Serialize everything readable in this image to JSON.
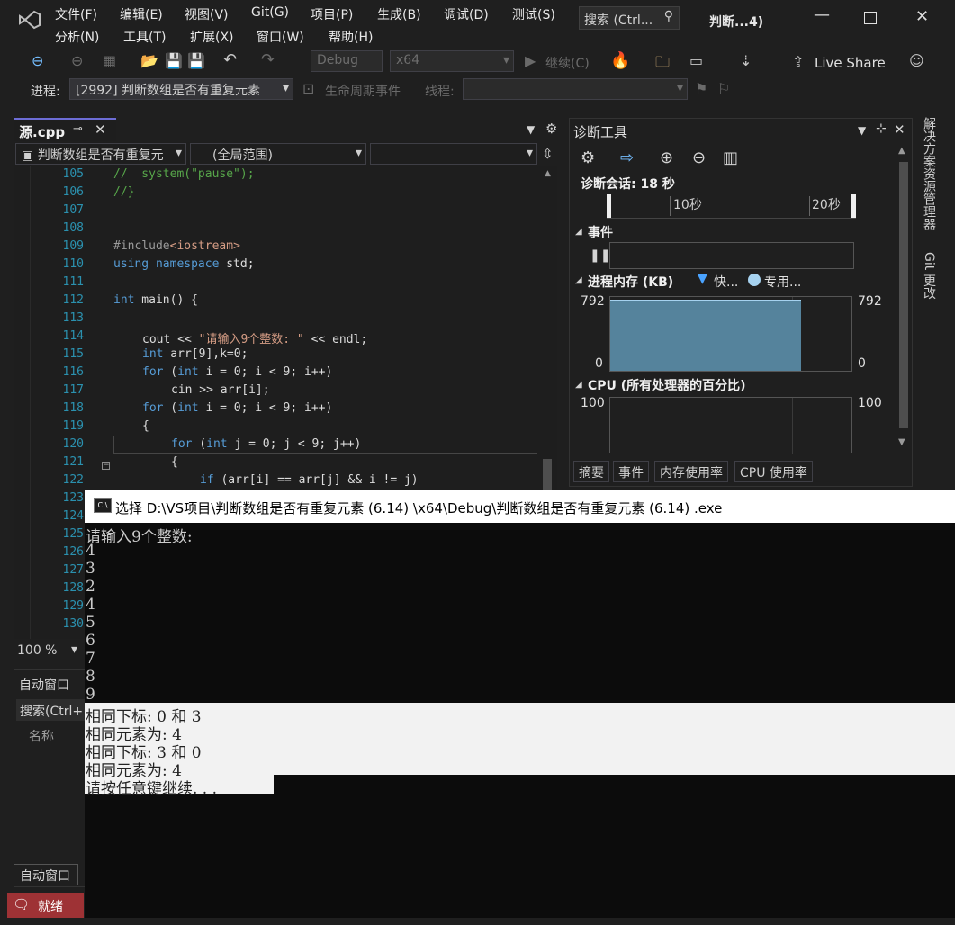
{
  "menu": {
    "row1": [
      "文件(F)",
      "编辑(E)",
      "视图(V)",
      "Git(G)",
      "项目(P)",
      "生成(B)",
      "调试(D)",
      "测试(S)"
    ],
    "row2": [
      "分析(N)",
      "工具(T)",
      "扩展(X)",
      "窗口(W)",
      "帮助(H)"
    ],
    "search_placeholder": "搜索 (Ctrl...",
    "window_title": "判断...4)"
  },
  "toolbar": {
    "config": "Debug",
    "platform": "x64",
    "continue_label": "继续(C)",
    "live_share": "Live Share"
  },
  "debugbar": {
    "process_label": "进程:",
    "process_value": "[2992] 判断数组是否有重复元素",
    "lifecycle_label": "生命周期事件",
    "thread_label": "线程:"
  },
  "editor": {
    "tab_name": "源.cpp",
    "scope_project": "判断数组是否有重复元",
    "scope_global": "(全局范围)",
    "zoom": "100 %",
    "line_numbers": [
      "105",
      "106",
      "107",
      "108",
      "109",
      "110",
      "111",
      "112",
      "113",
      "114",
      "115",
      "116",
      "117",
      "118",
      "119",
      "120",
      "121",
      "122",
      "123",
      "124",
      "125",
      "126",
      "127",
      "128",
      "129",
      "130",
      "131"
    ]
  },
  "diagnostics": {
    "title": "诊断工具",
    "session": "诊断会话: 18 秒",
    "tick_10": "10秒",
    "tick_20": "20秒",
    "events_label": "事件",
    "memory_label": "进程内存 (KB)",
    "legend_fast": "快...",
    "legend_private": "专用...",
    "mem_max_left": "792",
    "mem_max_right": "792",
    "mem_min_left": "0",
    "mem_min_right": "0",
    "cpu_label": "CPU (所有处理器的百分比)",
    "cpu_max_left": "100",
    "cpu_max_right": "100",
    "tabs": [
      "摘要",
      "事件",
      "内存使用率",
      "CPU 使用率"
    ],
    "memory_fill_fraction": 0.79
  },
  "side_tabs": {
    "solution_explorer": "解决方案资源管理器",
    "git_changes": "Git 更改"
  },
  "auto_window": {
    "title": "自动窗口",
    "search": "搜索(Ctrl+",
    "col_name": "名称",
    "bottom_tab": "自动窗口"
  },
  "status": {
    "ready": "就绪"
  },
  "console": {
    "title": "选择 D:\\VS项目\\判断数组是否有重复元素 (6.14) \\x64\\Debug\\判断数组是否有重复元素 (6.14) .exe",
    "lines": [
      "请输入9个整数:",
      "4",
      "3",
      "2",
      "4",
      "5",
      "6",
      "7",
      "8",
      "9"
    ],
    "selected_lines": [
      "相同下标: 0 和 3",
      "相同元素为: 4",
      "相同下标: 3 和 0",
      "相同元素为: 4"
    ],
    "last_line": "请按任意键继续. . ."
  }
}
